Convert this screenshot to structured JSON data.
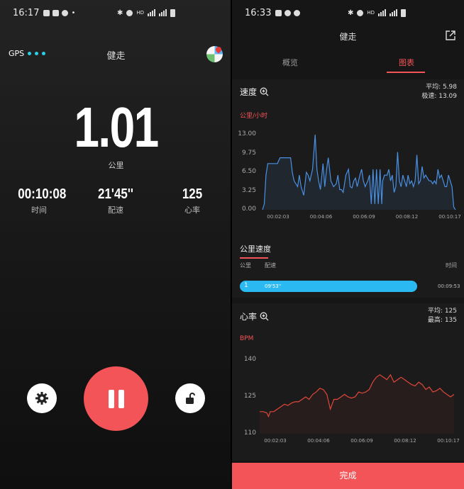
{
  "left": {
    "status_time": "16:17",
    "gps_label": "GPS",
    "title": "健走",
    "distance": "1.01",
    "distance_unit": "公里",
    "stats": [
      {
        "value": "00:10:08",
        "label": "时间"
      },
      {
        "value": "21'45''",
        "label": "配速"
      },
      {
        "value": "125",
        "label": "心率"
      }
    ]
  },
  "right": {
    "status_time": "16:33",
    "title": "健走",
    "tabs": [
      {
        "label": "概览",
        "active": false
      },
      {
        "label": "图表",
        "active": true
      }
    ],
    "speed_card": {
      "title": "速度",
      "avg_label": "平均: 5.98",
      "max_label": "极速: 13.09",
      "unit": "公里/小时"
    },
    "km_section": {
      "title": "公里速度",
      "col_km": "公里",
      "col_pace": "配速",
      "col_time": "时间",
      "row": {
        "km": "1",
        "pace": "09'53''",
        "time": "00:09:53"
      }
    },
    "hr_card": {
      "title": "心率",
      "avg_label": "平均: 125",
      "max_label": "最高: 135",
      "unit": "BPM"
    },
    "done_label": "完成"
  },
  "colors": {
    "accent": "#f35457",
    "speed_line": "#4a90e2",
    "hr_line": "#e0473a",
    "km_bar": "#2ab9f0"
  },
  "chart_data": [
    {
      "type": "area",
      "title": "速度",
      "ylabel": "公里/小时",
      "x_ticks": [
        "00:02:03",
        "00:04:06",
        "00:06:09",
        "00:08:12",
        "00:10:17"
      ],
      "y_ticks": [
        "13.00",
        "9.75",
        "6.50",
        "3.25",
        "0.00"
      ],
      "ylim": [
        0,
        13
      ],
      "grid": false,
      "series": [
        {
          "x": [
            0,
            0.1,
            0.2,
            0.3,
            0.5,
            0.7,
            0.85,
            1.0,
            1.3,
            1.6,
            1.7,
            1.8,
            2.0,
            2.1,
            2.2,
            2.35,
            2.5,
            2.6,
            2.7,
            2.85,
            3.0,
            3.1,
            3.2,
            3.3,
            3.45,
            3.55,
            3.65,
            3.75,
            3.9,
            4.05,
            4.2,
            4.3,
            4.4,
            4.5,
            4.6,
            4.75,
            4.9,
            5.0,
            5.1,
            5.2,
            5.3,
            5.4,
            5.55,
            5.65,
            5.75,
            5.85,
            6.0,
            6.1,
            6.2,
            6.3,
            6.4,
            6.5,
            6.6,
            6.7,
            6.8,
            6.85,
            6.95,
            7.1,
            7.2,
            7.3,
            7.4,
            7.5,
            7.6,
            7.7,
            7.8,
            7.9,
            8.0,
            8.1,
            8.2,
            8.3,
            8.4,
            8.5,
            8.6,
            8.7,
            8.8,
            8.9,
            9.0,
            9.1,
            9.2,
            9.3,
            9.4,
            9.5,
            9.6,
            9.7,
            9.8,
            9.9,
            10.0,
            10.1,
            10.2,
            10.3,
            10.4,
            10.5,
            10.6,
            10.7,
            10.8,
            10.9,
            11.0
          ],
          "y": [
            0,
            1,
            6,
            8,
            8,
            8,
            8,
            9,
            9,
            9,
            6.5,
            5,
            4,
            6,
            4,
            2.5,
            6.5,
            6,
            5,
            7,
            13,
            7,
            5,
            3.5,
            8,
            4,
            7,
            9,
            5,
            4,
            4.5,
            6,
            3.5,
            3.5,
            3,
            6,
            7,
            4,
            3.8,
            5,
            5.5,
            4,
            6,
            7,
            5,
            4,
            5,
            6,
            1,
            7,
            1,
            7,
            1,
            7,
            1,
            5,
            6,
            6,
            7,
            5,
            6,
            3,
            4,
            10,
            5,
            4,
            6,
            5,
            4,
            6,
            4.5,
            5,
            4,
            5,
            9.5,
            4.5,
            5,
            7.5,
            5.5,
            6,
            5.5,
            5,
            5,
            4.5,
            5,
            4.5,
            7,
            5.5,
            6,
            5,
            4,
            4,
            6,
            5,
            4,
            0.5,
            0
          ]
        }
      ]
    },
    {
      "type": "line",
      "title": "心率",
      "ylabel": "BPM",
      "x_ticks": [
        "00:02:03",
        "00:04:06",
        "00:06:09",
        "00:08:12",
        "00:10:17"
      ],
      "y_ticks": [
        "140",
        "125",
        "110"
      ],
      "ylim": [
        110,
        140
      ],
      "grid": false,
      "series": [
        {
          "x": [
            0,
            0.2,
            0.4,
            0.5,
            0.6,
            0.8,
            1.0,
            1.2,
            1.4,
            1.6,
            1.8,
            2.0,
            2.2,
            2.4,
            2.6,
            2.8,
            3.0,
            3.2,
            3.4,
            3.6,
            3.8,
            4.0,
            4.2,
            4.4,
            4.6,
            4.8,
            5.0,
            5.2,
            5.4,
            5.6,
            5.8,
            6.0,
            6.2,
            6.4,
            6.6,
            6.8,
            7.0,
            7.2,
            7.4,
            7.6,
            7.8,
            8.0,
            8.2,
            8.4,
            8.6,
            8.8,
            9.0,
            9.2,
            9.4,
            9.6,
            9.8,
            10.0,
            10.2,
            10.4,
            10.6,
            10.8,
            11.0
          ],
          "y": [
            119,
            119,
            118.5,
            117,
            119,
            119,
            120,
            121,
            122,
            121.5,
            122.5,
            123,
            123,
            124,
            125,
            124,
            126,
            127,
            128.5,
            128,
            126,
            120,
            124,
            124,
            125,
            126,
            125,
            124.5,
            125,
            127,
            126.5,
            127,
            128,
            131,
            133,
            134,
            133,
            132,
            134,
            131,
            132,
            133,
            132,
            131,
            130,
            129.5,
            131,
            130,
            128,
            129,
            127,
            127.5,
            128.5,
            127,
            126,
            125,
            126
          ]
        }
      ]
    }
  ]
}
